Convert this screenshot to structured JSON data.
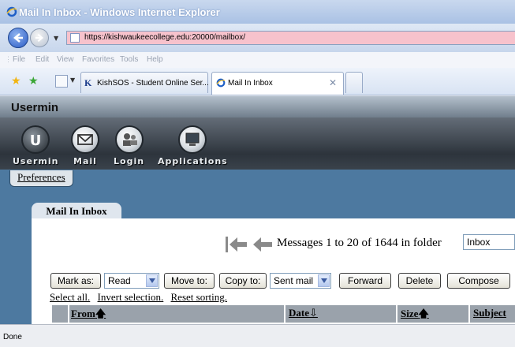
{
  "window": {
    "title": "Mail In Inbox - Windows Internet Explorer"
  },
  "address": {
    "url": "https://kishwaukeecollege.edu:20000/mailbox/"
  },
  "menu": [
    "File",
    "Edit",
    "View",
    "Favorites",
    "Tools",
    "Help"
  ],
  "tabs": [
    {
      "label": "KishSOS - Student Online Ser...",
      "icon": "kc-icon"
    },
    {
      "label": "Mail In Inbox",
      "icon": "ie-icon",
      "active": true
    }
  ],
  "usermin": {
    "brand": "Usermin",
    "toolbar": [
      "Usermin",
      "Mail",
      "Login",
      "Applications"
    ],
    "preferences_label": "Preferences",
    "inbox_tab": "Mail In Inbox"
  },
  "pager": {
    "info": "Messages 1 to 20 of 1644 in folder",
    "folder": "Inbox"
  },
  "actions": {
    "mark_as": "Mark as:",
    "mark_value": "Read",
    "move_to": "Move to:",
    "copy_to": "Copy to:",
    "copy_target": "Sent mail",
    "forward": "Forward",
    "delete": "Delete",
    "compose": "Compose"
  },
  "links": [
    "Select all.",
    "Invert selection.",
    "Reset sorting."
  ],
  "table": {
    "columns": [
      "From",
      "Date",
      "Size",
      "Subject"
    ]
  },
  "status": {
    "text": "Done"
  },
  "colors": {
    "address_bg": "#f7c2cc",
    "content_band": "#4d79a0",
    "toolbar_dark": "#2d343c",
    "table_header": "#9aa2ab"
  }
}
